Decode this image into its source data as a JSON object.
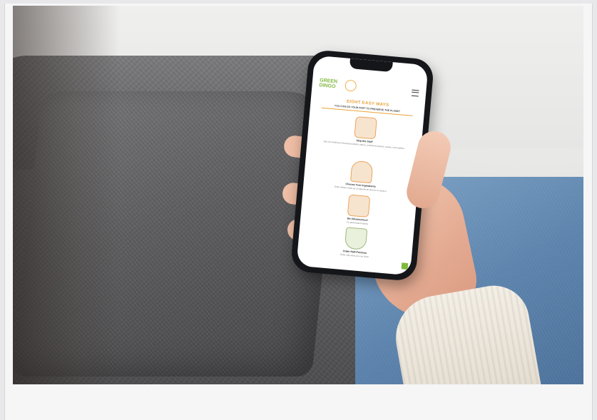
{
  "phone_screen": {
    "logo": "GREEN DINGO",
    "heading": "EIGHT EASY WAYS",
    "subheading": "YOU CAN DO YOUR PART TO PRESERVE THE PLANET",
    "items": [
      {
        "title": "Skip the Stuff",
        "desc": "Opt out of taking unnecessary plastic cutlery, condiment packets, straws, and napkins.",
        "icon": "plastic-icon"
      },
      {
        "title": "Choose Your Ingredients",
        "desc": "Order dishes made up of ingredients that are in season",
        "icon": "produce-icon"
      },
      {
        "title": "Be Adventurous!",
        "desc": "Try plant-based dishes",
        "icon": "burger-icon"
      },
      {
        "title": "Order Half-Portions",
        "desc": "Order only what you can finish",
        "icon": "plate-icon"
      }
    ]
  },
  "colors": {
    "accent": "#e8a33a",
    "brand_green": "#7fb83e"
  }
}
